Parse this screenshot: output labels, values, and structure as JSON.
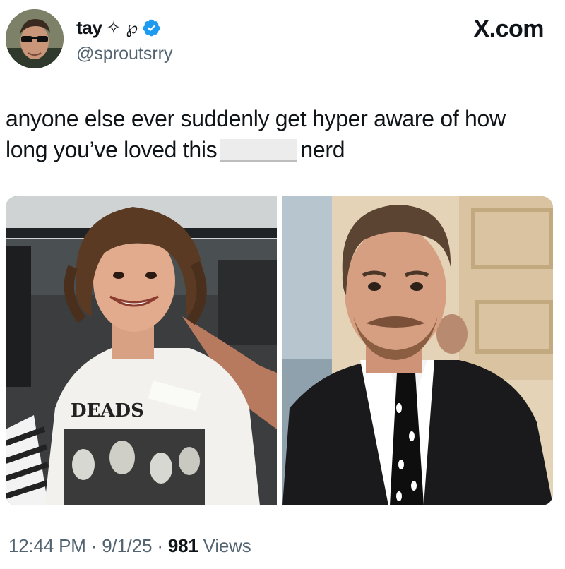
{
  "tweet": {
    "display_name": "tay",
    "name_decoration": "✧ ℘",
    "handle": "@sproutsrry",
    "verified": true,
    "avatar_icon": "profile-photo",
    "text_line1": "anyone else ever suddenly get hyper aware of how",
    "text_line2_before": "long you’ve loved this",
    "text_line2_after": "nerd",
    "time": "12:44 PM",
    "date": "9/1/25",
    "separator": "·",
    "views_count": "981",
    "views_label": "Views"
  },
  "site": {
    "label": "X.com"
  },
  "media": [
    {
      "description_icon": "photo-young-man-curly-hair",
      "shirt_text": "DEADS"
    },
    {
      "description_icon": "photo-man-mustache-suit"
    }
  ],
  "colors": {
    "text": "#0f1419",
    "secondary_text": "#536471",
    "verified_blue": "#1d9bf0"
  }
}
